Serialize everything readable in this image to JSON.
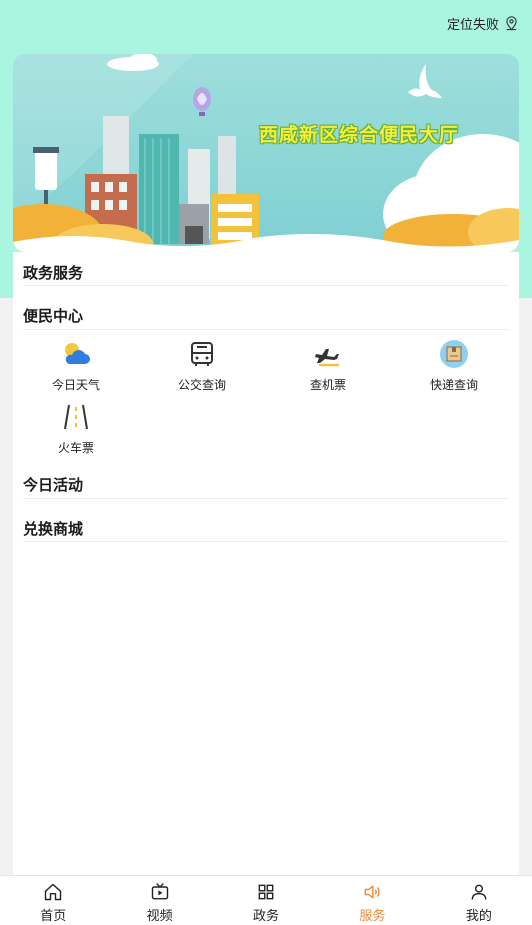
{
  "header": {
    "location_status": "定位失败",
    "location_icon": "location-pin-icon"
  },
  "banner": {
    "title": "西咸新区综合便民大厅"
  },
  "sections": {
    "government": "政务服务",
    "convenience": "便民中心",
    "today_activity": "今日活动",
    "exchange_mall": "兑换商城"
  },
  "convenience_items": [
    {
      "label": "今日天气",
      "icon": "weather-icon"
    },
    {
      "label": "公交查询",
      "icon": "bus-icon"
    },
    {
      "label": "查机票",
      "icon": "airplane-icon"
    },
    {
      "label": "快递查询",
      "icon": "package-icon"
    },
    {
      "label": "火车票",
      "icon": "railway-icon"
    }
  ],
  "tabs": [
    {
      "label": "首页",
      "icon": "home-icon"
    },
    {
      "label": "视频",
      "icon": "video-icon"
    },
    {
      "label": "政务",
      "icon": "grid-icon"
    },
    {
      "label": "服务",
      "icon": "speaker-icon",
      "active": true
    },
    {
      "label": "我的",
      "icon": "user-icon"
    }
  ],
  "colors": {
    "accent": "#f08a3c",
    "header_bg": "#a9f5df",
    "banner_sky": "#8fd8d6"
  }
}
